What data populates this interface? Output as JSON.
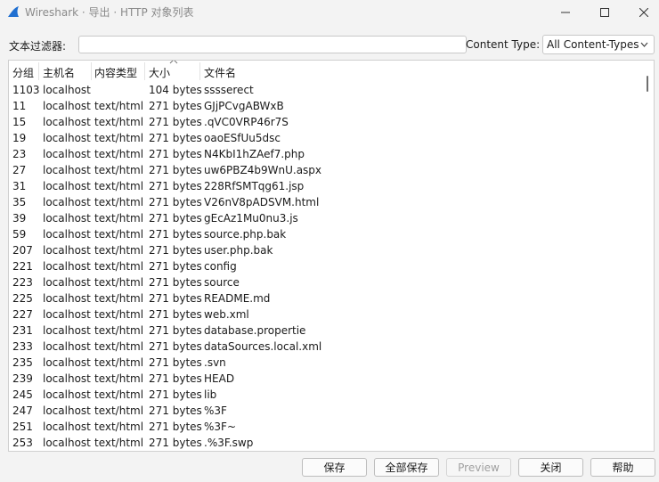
{
  "window": {
    "title": "Wireshark · 导出 · HTTP 对象列表",
    "minimize_glyph": "—",
    "maximize_glyph": "☐",
    "close_glyph": "✕"
  },
  "toolbar": {
    "filter_label": "文本过滤器:",
    "filter_value": "",
    "content_type_label": "Content Type:",
    "content_type_value": "All Content-Types"
  },
  "table": {
    "columns": [
      "分组",
      "主机名",
      "内容类型",
      "大小",
      "文件名"
    ],
    "sort_column": "大小",
    "rows": [
      {
        "num": "1103",
        "host": "localhost",
        "type": "",
        "size": "104 bytes",
        "file": "sssserect"
      },
      {
        "num": "11",
        "host": "localhost",
        "type": "text/html",
        "size": "271 bytes",
        "file": "GJjPCvgABWxB"
      },
      {
        "num": "15",
        "host": "localhost",
        "type": "text/html",
        "size": "271 bytes",
        "file": ".qVC0VRP46r7S"
      },
      {
        "num": "19",
        "host": "localhost",
        "type": "text/html",
        "size": "271 bytes",
        "file": "oaoESfUu5dsc"
      },
      {
        "num": "23",
        "host": "localhost",
        "type": "text/html",
        "size": "271 bytes",
        "file": "N4KbI1hZAef7.php"
      },
      {
        "num": "27",
        "host": "localhost",
        "type": "text/html",
        "size": "271 bytes",
        "file": "uw6PBZ4b9WnU.aspx"
      },
      {
        "num": "31",
        "host": "localhost",
        "type": "text/html",
        "size": "271 bytes",
        "file": "228RfSMTqg61.jsp"
      },
      {
        "num": "35",
        "host": "localhost",
        "type": "text/html",
        "size": "271 bytes",
        "file": "V26nV8pADSVM.html"
      },
      {
        "num": "39",
        "host": "localhost",
        "type": "text/html",
        "size": "271 bytes",
        "file": "gEcAz1Mu0nu3.js"
      },
      {
        "num": "59",
        "host": "localhost",
        "type": "text/html",
        "size": "271 bytes",
        "file": "source.php.bak"
      },
      {
        "num": "207",
        "host": "localhost",
        "type": "text/html",
        "size": "271 bytes",
        "file": "user.php.bak"
      },
      {
        "num": "221",
        "host": "localhost",
        "type": "text/html",
        "size": "271 bytes",
        "file": "config"
      },
      {
        "num": "223",
        "host": "localhost",
        "type": "text/html",
        "size": "271 bytes",
        "file": "source"
      },
      {
        "num": "225",
        "host": "localhost",
        "type": "text/html",
        "size": "271 bytes",
        "file": "README.md"
      },
      {
        "num": "227",
        "host": "localhost",
        "type": "text/html",
        "size": "271 bytes",
        "file": "web.xml"
      },
      {
        "num": "231",
        "host": "localhost",
        "type": "text/html",
        "size": "271 bytes",
        "file": "database.propertie"
      },
      {
        "num": "233",
        "host": "localhost",
        "type": "text/html",
        "size": "271 bytes",
        "file": "dataSources.local.xml"
      },
      {
        "num": "235",
        "host": "localhost",
        "type": "text/html",
        "size": "271 bytes",
        "file": ".svn"
      },
      {
        "num": "239",
        "host": "localhost",
        "type": "text/html",
        "size": "271 bytes",
        "file": "HEAD"
      },
      {
        "num": "245",
        "host": "localhost",
        "type": "text/html",
        "size": "271 bytes",
        "file": "lib"
      },
      {
        "num": "247",
        "host": "localhost",
        "type": "text/html",
        "size": "271 bytes",
        "file": "%3F"
      },
      {
        "num": "251",
        "host": "localhost",
        "type": "text/html",
        "size": "271 bytes",
        "file": "%3F~"
      },
      {
        "num": "253",
        "host": "localhost",
        "type": "text/html",
        "size": "271 bytes",
        "file": ".%3F.swp"
      }
    ]
  },
  "buttons": {
    "save": "保存",
    "save_all": "全部保存",
    "preview": "Preview",
    "close": "关闭",
    "help": "帮助"
  },
  "colors": {
    "app_icon": "#1f6fd1",
    "accent": "#0067c0"
  }
}
